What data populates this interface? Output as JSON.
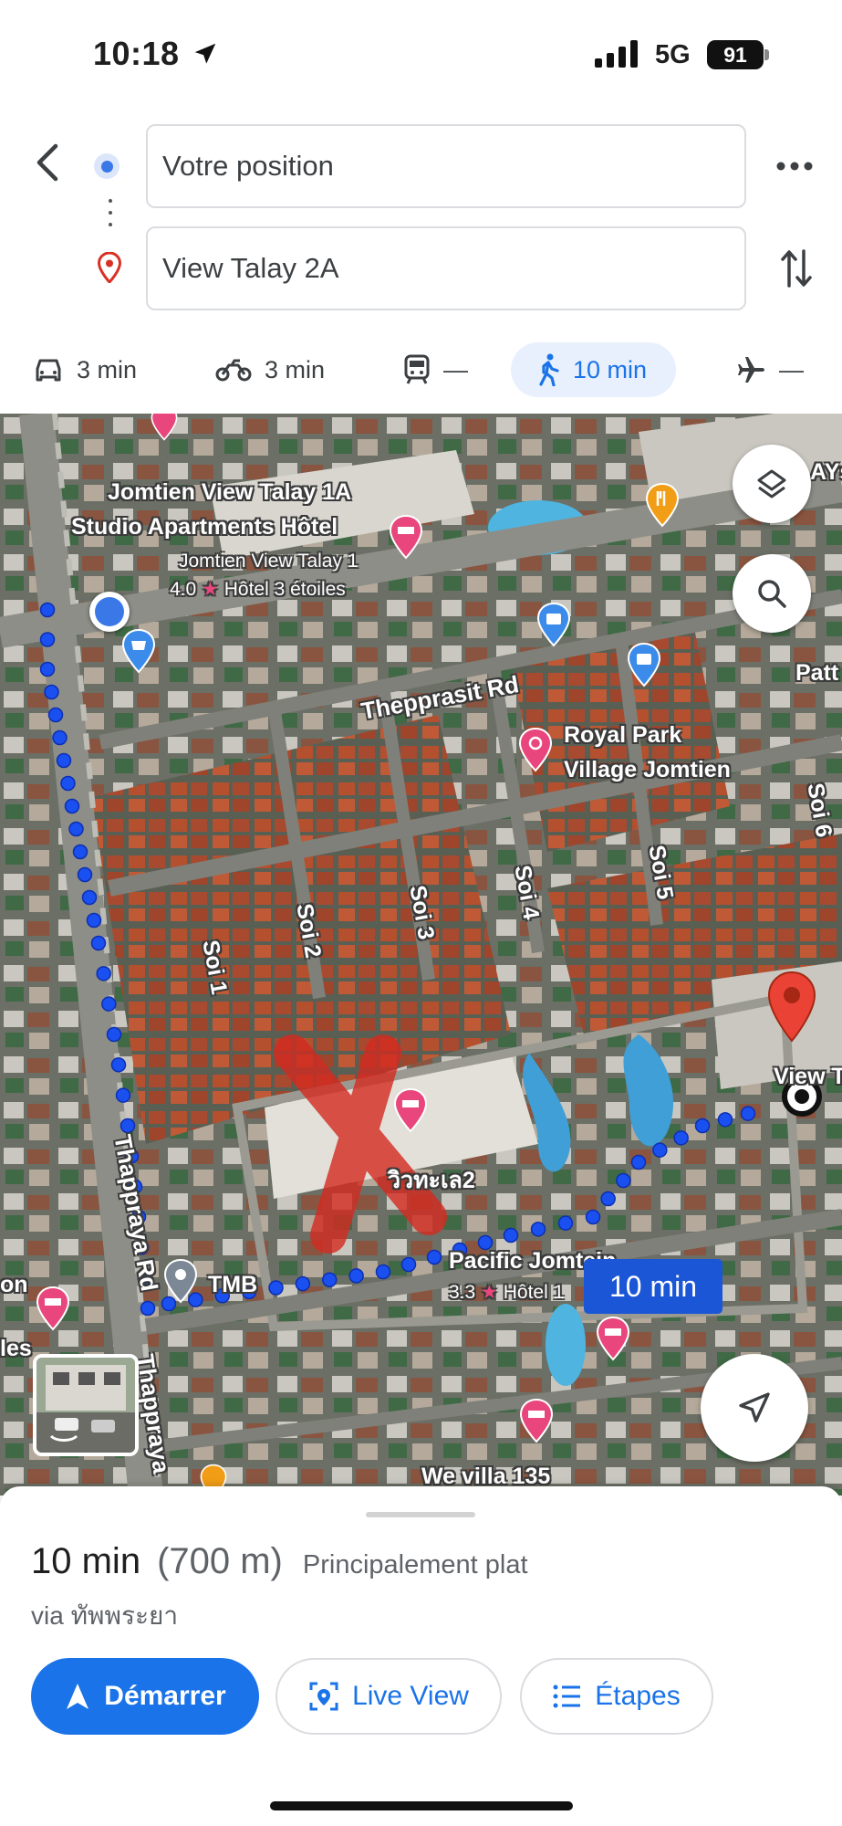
{
  "status_bar": {
    "time": "10:18",
    "network": "5G",
    "battery": "91"
  },
  "route": {
    "origin": "Votre position",
    "destination": "View Talay 2A"
  },
  "modes": [
    {
      "name": "car",
      "value": "3 min"
    },
    {
      "name": "motorcycle",
      "value": "3 min"
    },
    {
      "name": "transit",
      "value": "—"
    },
    {
      "name": "walk",
      "value": "10 min",
      "selected": true
    },
    {
      "name": "flight",
      "value": "—"
    }
  ],
  "map": {
    "labels": {
      "hotel1_line1": "Jomtien View Talay 1A",
      "hotel1_line2": "Studio Apartments Hôtel",
      "hotel2_name": "Jomtien View Talay 1",
      "hotel2_rating": "4.0",
      "hotel2_type": "Hôtel 3 étoiles",
      "road_thepprasit": "Thepprasit Rd",
      "royal_park_line1": "Royal Park",
      "royal_park_line2": "Village Jomtien",
      "soi1": "Soi 1",
      "soi2": "Soi 2",
      "soi3": "Soi 3",
      "soi4": "Soi 4",
      "soi5": "Soi 5",
      "soi6": "Soi 6",
      "thai_hotel": "วิวทะเล2",
      "pacific": "Pacific Jomtein",
      "pacific_rating": "3.3",
      "pacific_type": "Hôtel 1",
      "tmb": "TMB",
      "thappraya": "Thappraya Rd",
      "thappraya2": "Thappraya",
      "we_villa": "We villa 135",
      "patt": "Patt",
      "ays": "AYs",
      "view_t": "View T",
      "edge_on": "on",
      "edge_les": "les"
    },
    "eta_badge": "10 min"
  },
  "sheet": {
    "duration": "10 min",
    "distance": "(700 m)",
    "terrain": "Principalement plat",
    "via": "via ทัพพระยา",
    "start_label": "Démarrer",
    "live_view_label": "Live View",
    "steps_label": "Étapes"
  },
  "colors": {
    "accent": "#1a73e8",
    "route": "#1a4ff0",
    "pin": "#ea4335",
    "hotel_pin": "#e8467c"
  }
}
